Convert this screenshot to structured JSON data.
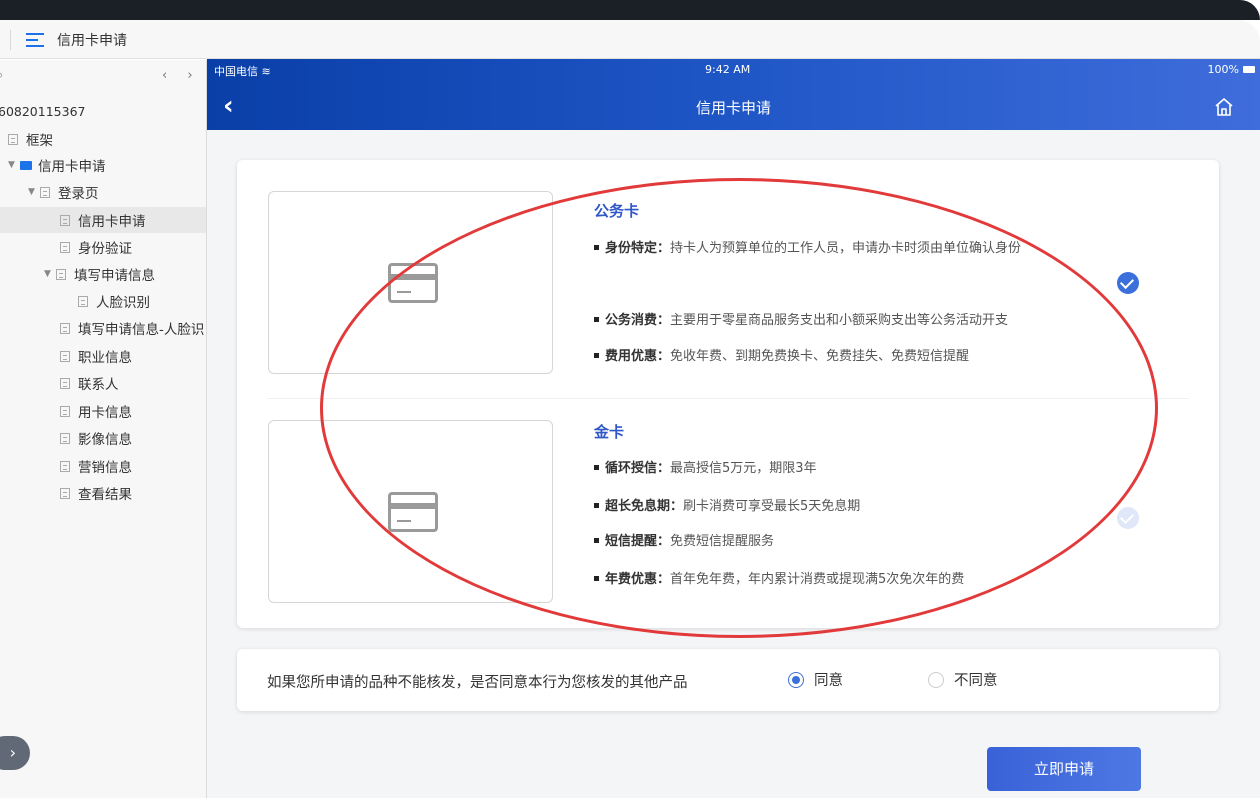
{
  "topbar": {
    "title": "信用卡申请"
  },
  "sidebar": {
    "nav_arrows": "‹ ›",
    "project_id": "60820115367",
    "items": [
      {
        "label": "框架"
      },
      {
        "label": "信用卡申请"
      },
      {
        "label": "登录页"
      },
      {
        "label": "信用卡申请"
      },
      {
        "label": "身份验证"
      },
      {
        "label": "填写申请信息"
      },
      {
        "label": "人脸识别"
      },
      {
        "label": "填写申请信息-人脸识"
      },
      {
        "label": "职业信息"
      },
      {
        "label": "联系人"
      },
      {
        "label": "用卡信息"
      },
      {
        "label": "影像信息"
      },
      {
        "label": "营销信息"
      },
      {
        "label": "查看结果"
      }
    ]
  },
  "status_bar": {
    "carrier": "中国电信",
    "time": "9:42 AM",
    "battery": "100%"
  },
  "header": {
    "title": "信用卡申请"
  },
  "options": [
    {
      "title": "公务卡",
      "selected": true,
      "features": [
        {
          "key": "身份特定",
          "value": "持卡人为预算单位的工作人员，申请办卡时须由单位确认身份"
        },
        {
          "key": "公务消费",
          "value": "主要用于零星商品服务支出和小额采购支出等公务活动开支"
        },
        {
          "key": "费用优惠",
          "value": "免收年费、到期免费换卡、免费挂失、免费短信提醒"
        }
      ]
    },
    {
      "title": "金卡",
      "selected": false,
      "features": [
        {
          "key": "循环授信",
          "value": "最高授信5万元，期限3年"
        },
        {
          "key": "超长免息期",
          "value": "刷卡消费可享受最长5天免息期"
        },
        {
          "key": "短信提醒",
          "value": "免费短信提醒服务"
        },
        {
          "key": "年费优惠",
          "value": "首年免年费，年内累计消费或提现满5次免次年的费"
        }
      ]
    }
  ],
  "agreement": {
    "question": "如果您所申请的品种不能核发，是否同意本行为您核发的其他产品",
    "agree_label": "同意",
    "disagree_label": "不同意",
    "selected": "同意"
  },
  "apply_button": "立即申请",
  "colors": {
    "accent": "#3b6fdb",
    "header_start": "#0a3fa8",
    "header_end": "#3f6ddb",
    "annotation": "#e23a3a"
  }
}
